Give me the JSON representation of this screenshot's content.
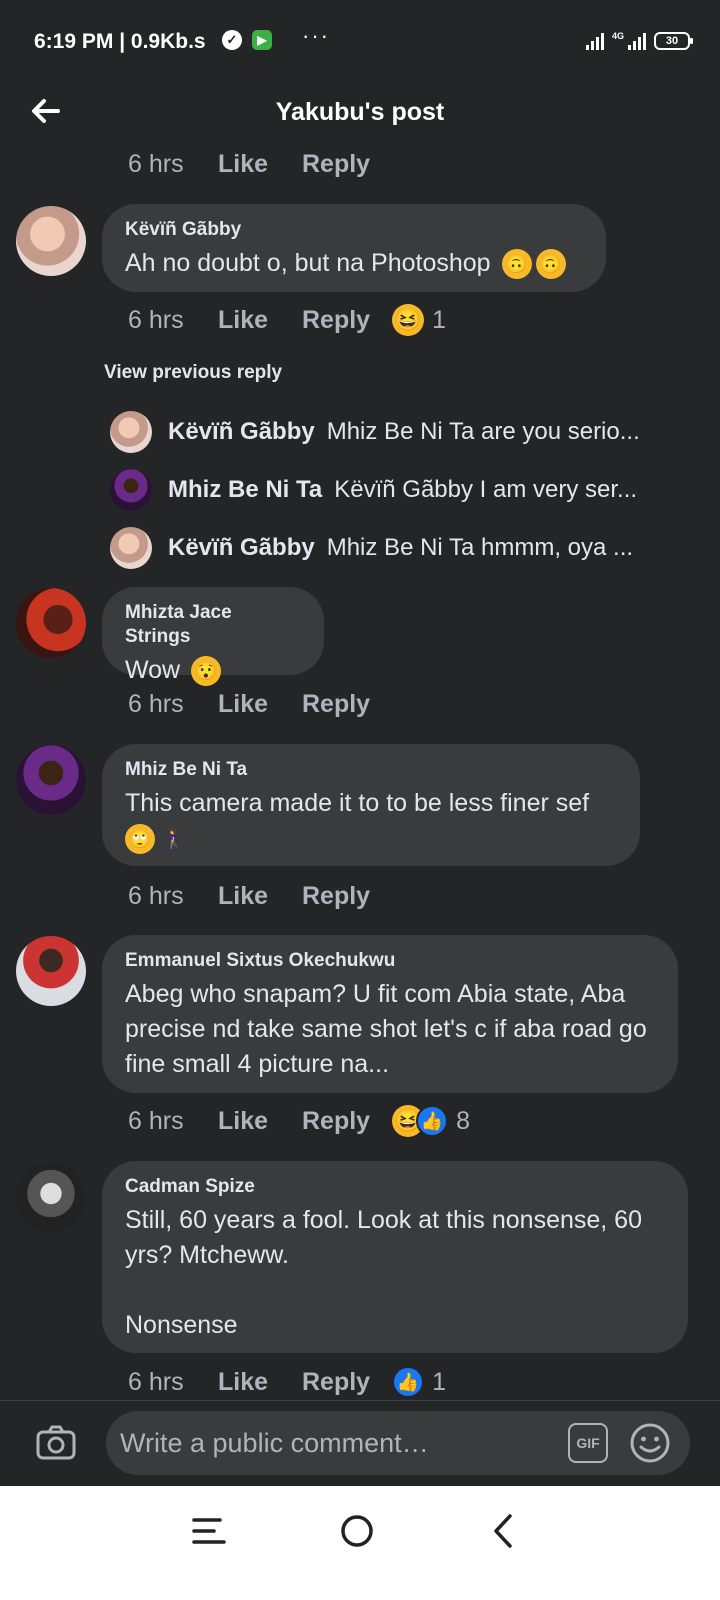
{
  "status_bar": {
    "time": "6:19 PM | 0.9Kb.s",
    "network": "4G",
    "battery": "30",
    "more": "···"
  },
  "header": {
    "title": "Yakubu's post"
  },
  "comments": [
    {
      "time": "6 hrs",
      "like": "Like",
      "reply": "Reply"
    },
    {
      "name": "Këvïñ Gãbby",
      "text": "Ah no doubt o, but na Photoshop",
      "emojis": [
        "🙃",
        "🙃"
      ],
      "time": "6 hrs",
      "like": "Like",
      "reply": "Reply",
      "reactions": {
        "icons": [
          "laugh"
        ],
        "count": "1"
      },
      "view_previous": "View previous reply",
      "replies": [
        {
          "name": "Këvïñ Gãbby",
          "text": "Mhiz Be Ni Ta are you serio..."
        },
        {
          "name": "Mhiz Be Ni Ta",
          "text": "Këvïñ Gãbby I am very ser..."
        },
        {
          "name": "Këvïñ Gãbby",
          "text": "Mhiz Be Ni Ta hmmm, oya ..."
        }
      ]
    },
    {
      "name": "Mhizta Jace Strings",
      "text": "Wow",
      "emojis": [
        "😯"
      ],
      "time": "6 hrs",
      "like": "Like",
      "reply": "Reply"
    },
    {
      "name": "Mhiz Be Ni Ta",
      "text": "This camera made it to to be less finer sef",
      "emojis": [
        "🙄",
        "🚶‍♀️"
      ],
      "time": "6 hrs",
      "like": "Like",
      "reply": "Reply"
    },
    {
      "name": "Emmanuel Sixtus Okechukwu",
      "text": "Abeg who  snapam? U fit com Abia state, Aba precise nd take same shot let's c if aba road go fine small 4 picture na...",
      "time": "6 hrs",
      "like": "Like",
      "reply": "Reply",
      "reactions": {
        "icons": [
          "laugh",
          "thumb"
        ],
        "count": "8"
      }
    },
    {
      "name": "Cadman Spize",
      "text": "Still, 60 years a fool. Look at this nonsense, 60 yrs? Mtcheww.\n\nNonsense",
      "time": "6 hrs",
      "like": "Like",
      "reply": "Reply",
      "reactions": {
        "icons": [
          "thumb"
        ],
        "count": "1"
      }
    }
  ],
  "composer": {
    "placeholder": "Write a public comment…",
    "gif_label": "GIF"
  },
  "colors": {
    "background": "#242526",
    "bubble": "#3a3b3c",
    "text": "#e4e6eb",
    "secondary_text": "#b0b3b8",
    "like_blue": "#1877f2",
    "haha_yellow": "#f7b928"
  }
}
